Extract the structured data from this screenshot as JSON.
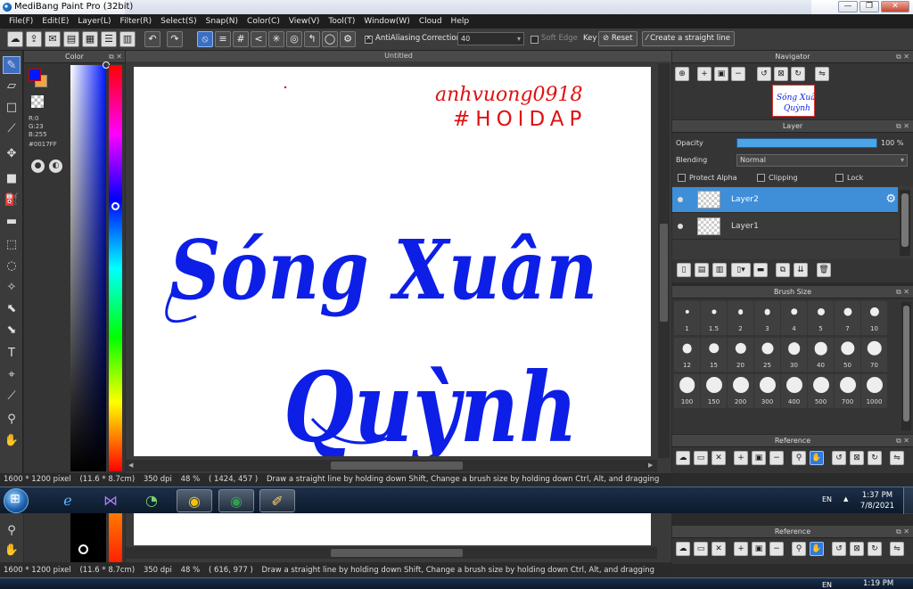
{
  "window": {
    "title": "MediBang Paint Pro (32bit)",
    "controls": [
      "—",
      "❐",
      "✕"
    ]
  },
  "menu": [
    "File(F)",
    "Edit(E)",
    "Layer(L)",
    "Filter(R)",
    "Select(S)",
    "Snap(N)",
    "Color(C)",
    "View(V)",
    "Tool(T)",
    "Window(W)",
    "Cloud",
    "Help"
  ],
  "tool_options": {
    "antialiasing_label": "AntiAliasing",
    "antialiasing_checked": true,
    "correction_label": "Correction",
    "correction_value": "40",
    "soft_edge_label": "Soft Edge",
    "soft_edge_checked": false,
    "key_label": "Key",
    "reset_label": "Reset",
    "straight_line_label": "Create a straight line"
  },
  "color_panel": {
    "title": "Color",
    "r": "R:0",
    "g": "G:23",
    "b": "B:255",
    "hex": "#0017FF",
    "foreground": "#0017ff",
    "background": "#f2a63c"
  },
  "canvas": {
    "title": "Untitled",
    "watermark_line1": "anhvuong0918",
    "watermark_line2": "#HOIDAP",
    "text_line1": "Sóng Xuân",
    "text_line2": "Quỳnh",
    "ink_color": "#0d1fe6",
    "watermark_color": "#e01010"
  },
  "navigator": {
    "title": "Navigator"
  },
  "layer_panel": {
    "title": "Layer",
    "opacity_label": "Opacity",
    "opacity_value": "100 %",
    "opacity_fraction": 1.0,
    "blending_label": "Blending",
    "blending_value": "Normal",
    "protect_alpha_label": "Protect Alpha",
    "clipping_label": "Clipping",
    "lock_label": "Lock",
    "layers": [
      {
        "name": "Layer2",
        "active": true
      },
      {
        "name": "Layer1",
        "active": false
      }
    ]
  },
  "brush_size": {
    "title": "Brush Size",
    "sizes": [
      "1",
      "1.5",
      "2",
      "3",
      "4",
      "5",
      "7",
      "10",
      "12",
      "15",
      "20",
      "25",
      "30",
      "40",
      "50",
      "70",
      "100",
      "150",
      "200",
      "300",
      "400",
      "500",
      "700",
      "1000"
    ]
  },
  "reference": {
    "title": "Reference"
  },
  "status": {
    "size": "1600 * 1200 pixel",
    "cm": "(11.6 * 8.7cm)",
    "dpi": "350 dpi",
    "zoom": "48 %",
    "coords": "( 1424, 457 )",
    "hint": "Draw a straight line by holding down Shift, Change a brush size by holding down Ctrl, Alt, and dragging"
  },
  "taskbar": {
    "lang": "EN",
    "time": "1:37 PM",
    "date": "7/8/2021"
  },
  "ghost": {
    "status_size": "1600 * 1200 pixel",
    "status_cm": "(11.6 * 8.7cm)",
    "status_dpi": "350 dpi",
    "status_zoom": "48 %",
    "status_coords": "( 616, 977 )",
    "status_hint": "Draw a straight line by holding down Shift, Change a brush size by holding down Ctrl, Alt, and dragging",
    "reference_title": "Reference",
    "lang": "EN",
    "time": "1:19 PM"
  }
}
